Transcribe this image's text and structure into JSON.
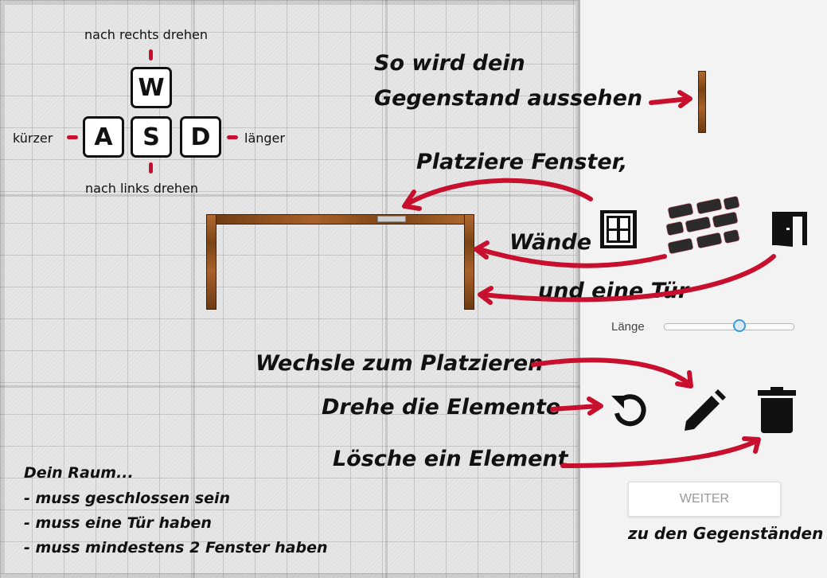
{
  "controls": {
    "rotate_right": "nach rechts drehen",
    "rotate_left": "nach links drehen",
    "shorter": "kürzer",
    "longer": "länger",
    "keys": {
      "w": "W",
      "a": "A",
      "s": "S",
      "d": "D"
    }
  },
  "hints": {
    "preview_line1": "So wird dein",
    "preview_line2": "Gegenstand aussehen",
    "place_windows": "Platziere Fenster,",
    "walls": "Wände",
    "door": "und eine Tür",
    "switch": "Wechsle zum Platzieren",
    "rotate": "Drehe die Elemente",
    "delete": "Lösche ein Element"
  },
  "rules": {
    "title": "Dein Raum...",
    "items": [
      "- muss geschlossen sein",
      "- muss eine Tür haben",
      "- muss mindestens 2 Fenster haben"
    ]
  },
  "length_slider": {
    "label": "Länge",
    "value": 0.58
  },
  "next": {
    "label": "WEITER",
    "caption": "zu den Gegenständen"
  },
  "icons": {
    "window": "window-icon",
    "wall": "brick-wall-icon",
    "door": "door-icon",
    "rotate": "rotate-icon",
    "edit": "pencil-icon",
    "delete": "trash-icon"
  },
  "colors": {
    "accent_red": "#c8102e",
    "wood": "#8a4f1e"
  }
}
